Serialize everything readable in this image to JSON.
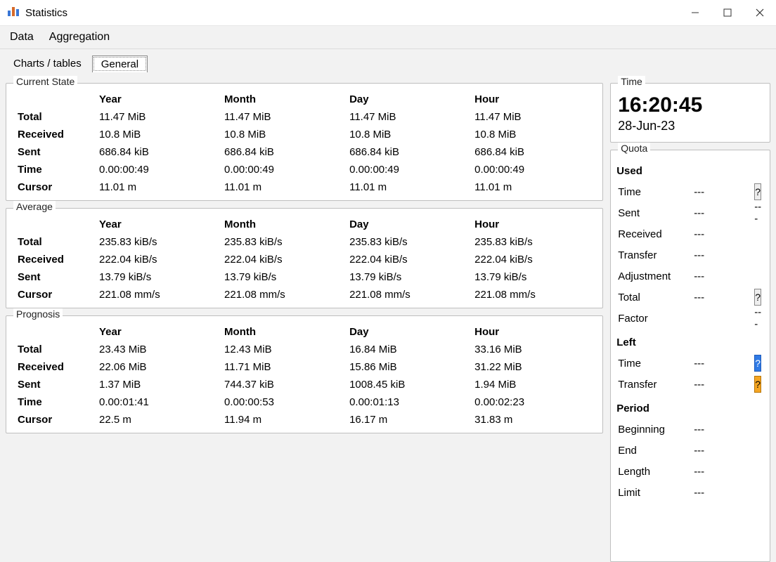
{
  "window": {
    "title": "Statistics"
  },
  "menu": {
    "data": "Data",
    "aggregation": "Aggregation"
  },
  "tabs": {
    "charts": "Charts / tables",
    "general": "General"
  },
  "columns": {
    "year": "Year",
    "month": "Month",
    "day": "Day",
    "hour": "Hour"
  },
  "rows": {
    "total": "Total",
    "received": "Received",
    "sent": "Sent",
    "time": "Time",
    "cursor": "Cursor"
  },
  "groups": {
    "current": {
      "legend": "Current State",
      "total": {
        "year": "11.47 MiB",
        "month": "11.47 MiB",
        "day": "11.47 MiB",
        "hour": "11.47 MiB"
      },
      "received": {
        "year": "10.8 MiB",
        "month": "10.8 MiB",
        "day": "10.8 MiB",
        "hour": "10.8 MiB"
      },
      "sent": {
        "year": "686.84 kiB",
        "month": "686.84 kiB",
        "day": "686.84 kiB",
        "hour": "686.84 kiB"
      },
      "time": {
        "year": "0.00:00:49",
        "month": "0.00:00:49",
        "day": "0.00:00:49",
        "hour": "0.00:00:49"
      },
      "cursor": {
        "year": "11.01 m",
        "month": "11.01 m",
        "day": "11.01 m",
        "hour": "11.01 m"
      }
    },
    "average": {
      "legend": "Average",
      "total": {
        "year": "235.83 kiB/s",
        "month": "235.83 kiB/s",
        "day": "235.83 kiB/s",
        "hour": "235.83 kiB/s"
      },
      "received": {
        "year": "222.04 kiB/s",
        "month": "222.04 kiB/s",
        "day": "222.04 kiB/s",
        "hour": "222.04 kiB/s"
      },
      "sent": {
        "year": "13.79 kiB/s",
        "month": "13.79 kiB/s",
        "day": "13.79 kiB/s",
        "hour": "13.79 kiB/s"
      },
      "cursor": {
        "year": "221.08 mm/s",
        "month": "221.08 mm/s",
        "day": "221.08 mm/s",
        "hour": "221.08 mm/s"
      }
    },
    "prognosis": {
      "legend": "Prognosis",
      "total": {
        "year": "23.43 MiB",
        "month": "12.43 MiB",
        "day": "16.84 MiB",
        "hour": "33.16 MiB"
      },
      "received": {
        "year": "22.06 MiB",
        "month": "11.71 MiB",
        "day": "15.86 MiB",
        "hour": "31.22 MiB"
      },
      "sent": {
        "year": "1.37 MiB",
        "month": "744.37 kiB",
        "day": "1008.45 kiB",
        "hour": "1.94 MiB"
      },
      "time": {
        "year": "0.00:01:41",
        "month": "0.00:00:53",
        "day": "0.00:01:13",
        "hour": "0.00:02:23"
      },
      "cursor": {
        "year": "22.5 m",
        "month": "11.94 m",
        "day": "16.17 m",
        "hour": "31.83 m"
      }
    }
  },
  "time": {
    "legend": "Time",
    "clock": "16:20:45",
    "date": "28-Jun-23"
  },
  "quota": {
    "legend": "Quota",
    "used_label": "Used",
    "left_label": "Left",
    "period_label": "Period",
    "q": "?",
    "labels": {
      "time": "Time",
      "sent": "Sent",
      "received": "Received",
      "transfer": "Transfer",
      "adjustment": "Adjustment",
      "total": "Total",
      "factor": "Factor",
      "beginning": "Beginning",
      "end": "End",
      "length": "Length",
      "limit": "Limit"
    },
    "used": {
      "time": "---",
      "sent": "---",
      "received": "---",
      "transfer": "---",
      "adjustment": "---",
      "total": "---",
      "factor": "---"
    },
    "left": {
      "time": "---",
      "transfer": "---"
    },
    "period": {
      "beginning": "---",
      "end": "---",
      "length": "---",
      "limit": "---"
    }
  }
}
